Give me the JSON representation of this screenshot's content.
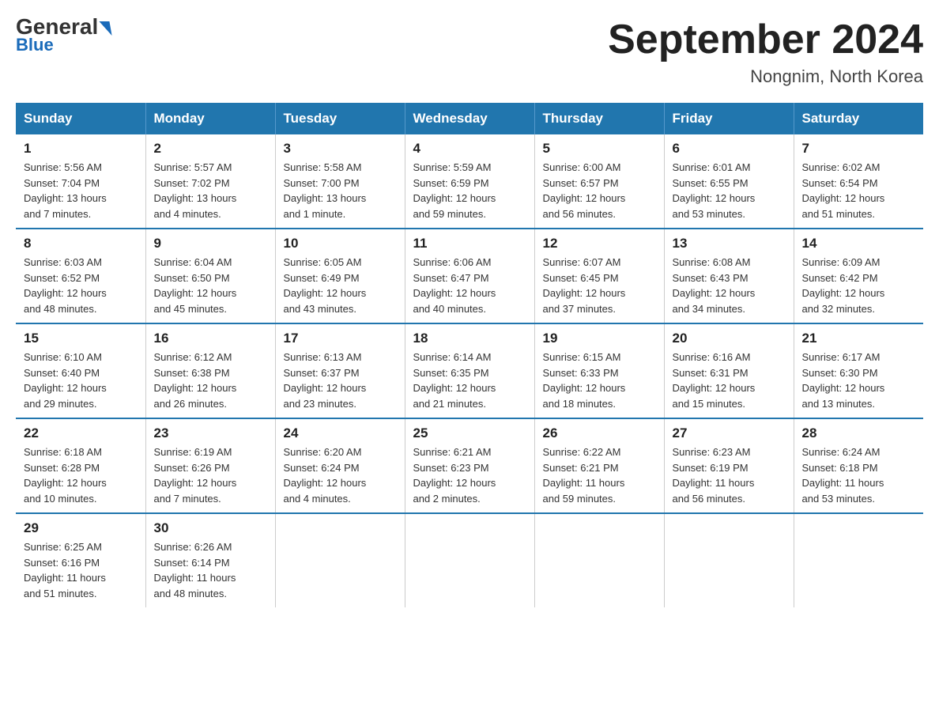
{
  "header": {
    "logo_general": "General",
    "logo_blue": "Blue",
    "month_title": "September 2024",
    "location": "Nongnim, North Korea"
  },
  "weekdays": [
    "Sunday",
    "Monday",
    "Tuesday",
    "Wednesday",
    "Thursday",
    "Friday",
    "Saturday"
  ],
  "weeks": [
    [
      {
        "day": "1",
        "sunrise": "5:56 AM",
        "sunset": "7:04 PM",
        "daylight": "13 hours and 7 minutes."
      },
      {
        "day": "2",
        "sunrise": "5:57 AM",
        "sunset": "7:02 PM",
        "daylight": "13 hours and 4 minutes."
      },
      {
        "day": "3",
        "sunrise": "5:58 AM",
        "sunset": "7:00 PM",
        "daylight": "13 hours and 1 minute."
      },
      {
        "day": "4",
        "sunrise": "5:59 AM",
        "sunset": "6:59 PM",
        "daylight": "12 hours and 59 minutes."
      },
      {
        "day": "5",
        "sunrise": "6:00 AM",
        "sunset": "6:57 PM",
        "daylight": "12 hours and 56 minutes."
      },
      {
        "day": "6",
        "sunrise": "6:01 AM",
        "sunset": "6:55 PM",
        "daylight": "12 hours and 53 minutes."
      },
      {
        "day": "7",
        "sunrise": "6:02 AM",
        "sunset": "6:54 PM",
        "daylight": "12 hours and 51 minutes."
      }
    ],
    [
      {
        "day": "8",
        "sunrise": "6:03 AM",
        "sunset": "6:52 PM",
        "daylight": "12 hours and 48 minutes."
      },
      {
        "day": "9",
        "sunrise": "6:04 AM",
        "sunset": "6:50 PM",
        "daylight": "12 hours and 45 minutes."
      },
      {
        "day": "10",
        "sunrise": "6:05 AM",
        "sunset": "6:49 PM",
        "daylight": "12 hours and 43 minutes."
      },
      {
        "day": "11",
        "sunrise": "6:06 AM",
        "sunset": "6:47 PM",
        "daylight": "12 hours and 40 minutes."
      },
      {
        "day": "12",
        "sunrise": "6:07 AM",
        "sunset": "6:45 PM",
        "daylight": "12 hours and 37 minutes."
      },
      {
        "day": "13",
        "sunrise": "6:08 AM",
        "sunset": "6:43 PM",
        "daylight": "12 hours and 34 minutes."
      },
      {
        "day": "14",
        "sunrise": "6:09 AM",
        "sunset": "6:42 PM",
        "daylight": "12 hours and 32 minutes."
      }
    ],
    [
      {
        "day": "15",
        "sunrise": "6:10 AM",
        "sunset": "6:40 PM",
        "daylight": "12 hours and 29 minutes."
      },
      {
        "day": "16",
        "sunrise": "6:12 AM",
        "sunset": "6:38 PM",
        "daylight": "12 hours and 26 minutes."
      },
      {
        "day": "17",
        "sunrise": "6:13 AM",
        "sunset": "6:37 PM",
        "daylight": "12 hours and 23 minutes."
      },
      {
        "day": "18",
        "sunrise": "6:14 AM",
        "sunset": "6:35 PM",
        "daylight": "12 hours and 21 minutes."
      },
      {
        "day": "19",
        "sunrise": "6:15 AM",
        "sunset": "6:33 PM",
        "daylight": "12 hours and 18 minutes."
      },
      {
        "day": "20",
        "sunrise": "6:16 AM",
        "sunset": "6:31 PM",
        "daylight": "12 hours and 15 minutes."
      },
      {
        "day": "21",
        "sunrise": "6:17 AM",
        "sunset": "6:30 PM",
        "daylight": "12 hours and 13 minutes."
      }
    ],
    [
      {
        "day": "22",
        "sunrise": "6:18 AM",
        "sunset": "6:28 PM",
        "daylight": "12 hours and 10 minutes."
      },
      {
        "day": "23",
        "sunrise": "6:19 AM",
        "sunset": "6:26 PM",
        "daylight": "12 hours and 7 minutes."
      },
      {
        "day": "24",
        "sunrise": "6:20 AM",
        "sunset": "6:24 PM",
        "daylight": "12 hours and 4 minutes."
      },
      {
        "day": "25",
        "sunrise": "6:21 AM",
        "sunset": "6:23 PM",
        "daylight": "12 hours and 2 minutes."
      },
      {
        "day": "26",
        "sunrise": "6:22 AM",
        "sunset": "6:21 PM",
        "daylight": "11 hours and 59 minutes."
      },
      {
        "day": "27",
        "sunrise": "6:23 AM",
        "sunset": "6:19 PM",
        "daylight": "11 hours and 56 minutes."
      },
      {
        "day": "28",
        "sunrise": "6:24 AM",
        "sunset": "6:18 PM",
        "daylight": "11 hours and 53 minutes."
      }
    ],
    [
      {
        "day": "29",
        "sunrise": "6:25 AM",
        "sunset": "6:16 PM",
        "daylight": "11 hours and 51 minutes."
      },
      {
        "day": "30",
        "sunrise": "6:26 AM",
        "sunset": "6:14 PM",
        "daylight": "11 hours and 48 minutes."
      },
      null,
      null,
      null,
      null,
      null
    ]
  ],
  "labels": {
    "sunrise": "Sunrise:",
    "sunset": "Sunset:",
    "daylight": "Daylight:"
  }
}
